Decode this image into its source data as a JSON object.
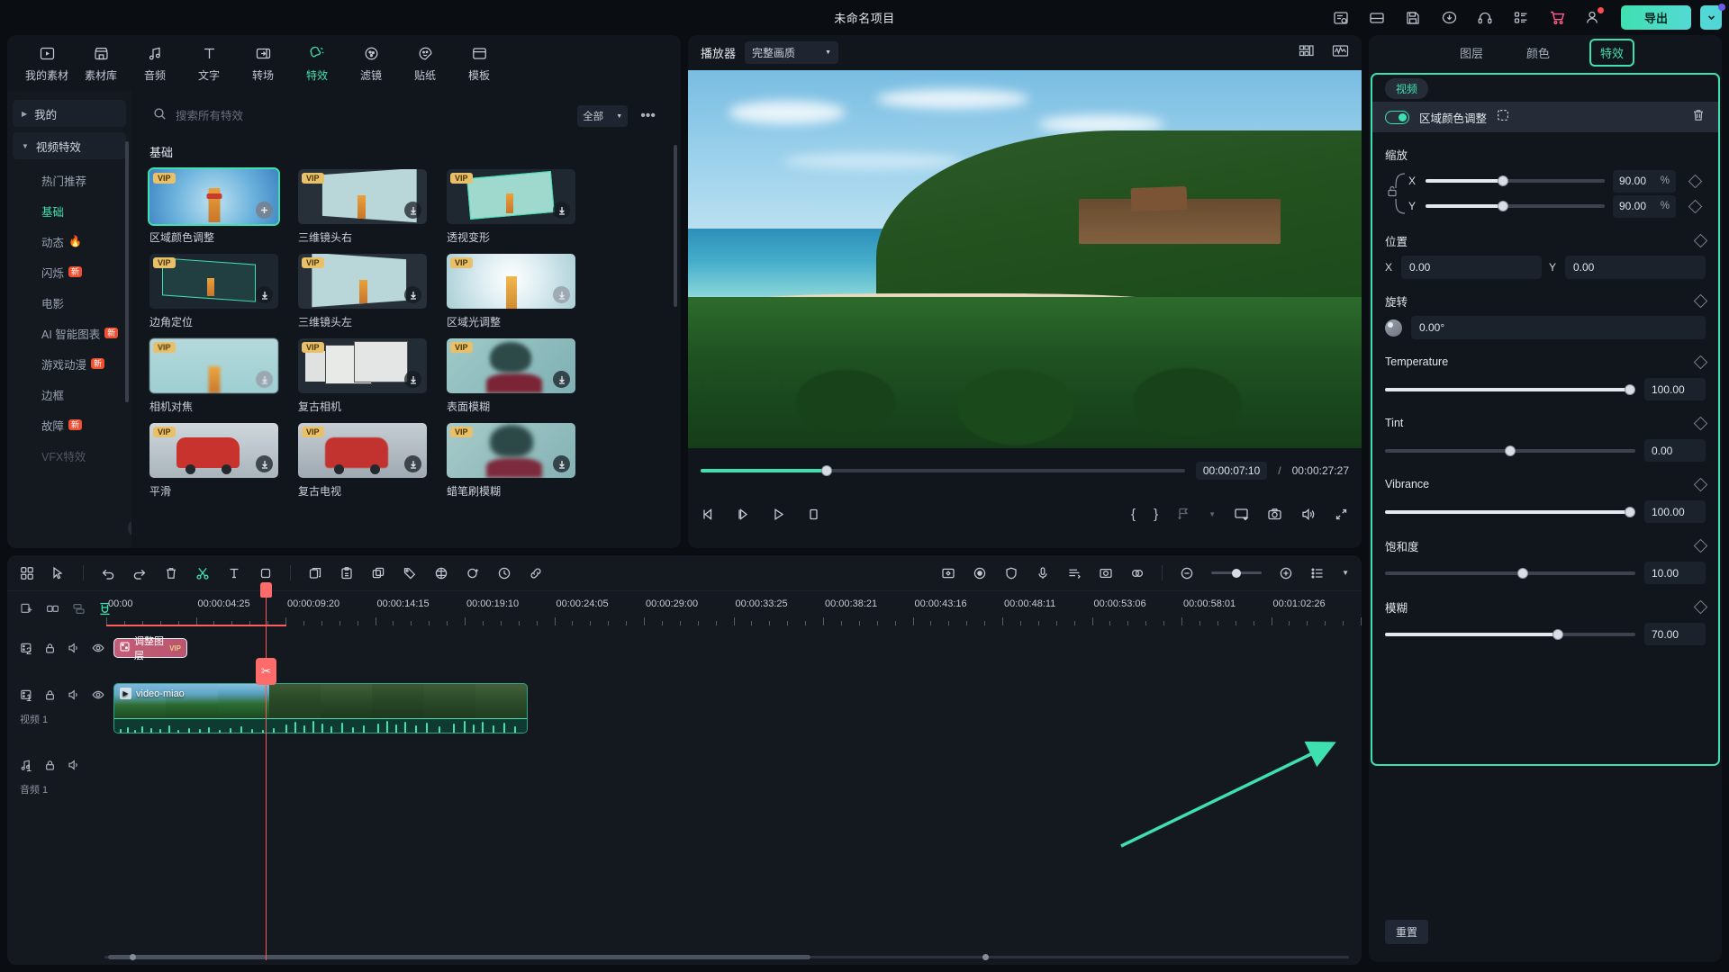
{
  "titlebar": {
    "project_title": "未命名项目",
    "export_label": "导出",
    "icons": [
      "notes-icon",
      "layout-icon",
      "save-icon",
      "cloud-upload-icon",
      "headset-icon",
      "apps-grid-icon",
      "cart-icon",
      "account-icon"
    ]
  },
  "media_panel": {
    "tabs": [
      {
        "label": "我的素材",
        "icon": "media-library-icon",
        "active": false
      },
      {
        "label": "素材库",
        "icon": "stock-store-icon",
        "active": false
      },
      {
        "label": "音频",
        "icon": "music-note-icon",
        "active": false
      },
      {
        "label": "文字",
        "icon": "text-t-icon",
        "active": false
      },
      {
        "label": "转场",
        "icon": "transition-icon",
        "active": false
      },
      {
        "label": "特效",
        "icon": "effects-sparkle-icon",
        "active": true
      },
      {
        "label": "滤镜",
        "icon": "filter-circle-icon",
        "active": false
      },
      {
        "label": "贴纸",
        "icon": "sticker-face-icon",
        "active": false
      },
      {
        "label": "模板",
        "icon": "template-icon",
        "active": false
      }
    ],
    "categories": [
      {
        "label": "我的",
        "type": "group",
        "expanded": false
      },
      {
        "label": "视频特效",
        "type": "group",
        "expanded": true
      },
      {
        "label": "热门推荐",
        "type": "item",
        "active": false,
        "tag": ""
      },
      {
        "label": "基础",
        "type": "item",
        "active": true,
        "tag": ""
      },
      {
        "label": "动态",
        "type": "item",
        "active": false,
        "tag": "🔥"
      },
      {
        "label": "闪烁",
        "type": "item",
        "active": false,
        "tag": "新"
      },
      {
        "label": "电影",
        "type": "item",
        "active": false,
        "tag": ""
      },
      {
        "label": "AI 智能图表",
        "type": "item",
        "active": false,
        "tag": "新"
      },
      {
        "label": "游戏动漫",
        "type": "item",
        "active": false,
        "tag": "新"
      },
      {
        "label": "边框",
        "type": "item",
        "active": false,
        "tag": ""
      },
      {
        "label": "故障",
        "type": "item",
        "active": false,
        "tag": "新"
      },
      {
        "label": "VFX特效",
        "type": "item",
        "active": false,
        "tag": ""
      }
    ],
    "search": {
      "placeholder": "搜索所有特效"
    },
    "filter": {
      "label": "全部"
    },
    "section_title": "基础",
    "effects": [
      {
        "name": "区域颜色调整",
        "vip": true,
        "selected": true,
        "action": "add"
      },
      {
        "name": "三维镜头右",
        "vip": true,
        "selected": false,
        "action": "download"
      },
      {
        "name": "透视变形",
        "vip": true,
        "selected": false,
        "action": "download"
      },
      {
        "name": "边角定位",
        "vip": true,
        "selected": false,
        "action": "download"
      },
      {
        "name": "三维镜头左",
        "vip": true,
        "selected": false,
        "action": "download"
      },
      {
        "name": "区域光调整",
        "vip": true,
        "selected": false,
        "action": "download"
      },
      {
        "name": "相机对焦",
        "vip": true,
        "selected": false,
        "action": "download"
      },
      {
        "name": "复古相机",
        "vip": true,
        "selected": false,
        "action": "download"
      },
      {
        "name": "表面模糊",
        "vip": true,
        "selected": false,
        "action": "download"
      },
      {
        "name": "平滑",
        "vip": true,
        "selected": false,
        "action": "download"
      },
      {
        "name": "复古电视",
        "vip": true,
        "selected": false,
        "action": "download"
      },
      {
        "name": "蜡笔刷模糊",
        "vip": true,
        "selected": false,
        "action": "download"
      }
    ]
  },
  "player": {
    "label": "播放器",
    "quality": "完整画质",
    "current_time": "00:00:07:10",
    "separator": "/",
    "total_time": "00:00:27:27",
    "progress_percent": 26,
    "controls": [
      "prev-frame-icon",
      "next-frame-icon",
      "play-icon",
      "stop-icon"
    ],
    "right_controls": [
      "mark-in-brace",
      "mark-out-brace",
      "add-marker-icon",
      "chevron-down-icon",
      "screen-icon",
      "snapshot-icon",
      "volume-icon",
      "fullscreen-icon"
    ],
    "head_right_icons": [
      "grid-layout-icon",
      "waveform-scope-icon"
    ]
  },
  "properties": {
    "tabs": [
      {
        "label": "图层",
        "active": false
      },
      {
        "label": "颜色",
        "active": false
      },
      {
        "label": "特效",
        "active": true
      }
    ],
    "sub_tab": "视频",
    "effect_name": "区域颜色调整",
    "effect_enabled": true,
    "mask_icon": "mask-select-icon",
    "delete_icon": "trash-icon",
    "scale": {
      "label": "缩放",
      "x": {
        "axis": "X",
        "value": "90.00",
        "unit": "%",
        "percent": 43
      },
      "y": {
        "axis": "Y",
        "value": "90.00",
        "unit": "%",
        "percent": 43
      },
      "linked": true
    },
    "position": {
      "label": "位置",
      "x": {
        "axis": "X",
        "value": "0.00"
      },
      "y": {
        "axis": "Y",
        "value": "0.00"
      }
    },
    "rotation": {
      "label": "旋转",
      "value": "0.00°"
    },
    "adjustments": [
      {
        "label": "Temperature",
        "value": "100.00",
        "percent": 98
      },
      {
        "label": "Tint",
        "value": "0.00",
        "percent": 50
      },
      {
        "label": "Vibrance",
        "value": "100.00",
        "percent": 98
      },
      {
        "label": "饱和度",
        "value": "10.00",
        "percent": 55
      },
      {
        "label": "模糊",
        "value": "70.00",
        "percent": 69
      }
    ],
    "reset_label": "重置"
  },
  "timeline": {
    "toolbar_left": [
      "grid-view-icon",
      "select-cursor-icon",
      "undo-icon",
      "redo-icon",
      "delete-icon",
      "split-scissors-icon",
      "text-tool-icon",
      "crop-icon",
      "copy-icon",
      "paste-icon",
      "duplicate-icon",
      "tag-icon",
      "color-match-icon",
      "auto-highlight-icon",
      "speed-clock-icon",
      "link-icon"
    ],
    "toolbar_right": [
      "keyframe-panel-icon",
      "record-icon",
      "shield-icon",
      "mic-icon",
      "subtitle-icon",
      "snapshot-track-icon",
      "transition-add-icon",
      "zoom-out-icon",
      "zoom-slider",
      "zoom-in-icon",
      "track-list-icon",
      "chevron-down-icon"
    ],
    "zoom_percent": 45,
    "ruler_icons": [
      "add-track-icon",
      "link-clip-icon",
      "split-track-icon",
      "magnet-snap-icon"
    ],
    "ruler_labels": [
      "00:00",
      "00:00:04:25",
      "00:00:09:20",
      "00:00:14:15",
      "00:00:19:10",
      "00:00:24:05",
      "00:00:29:00",
      "00:00:33:25",
      "00:00:38:21",
      "00:00:43:16",
      "00:00:48:11",
      "00:00:53:06",
      "00:00:58:01",
      "00:01:02:26"
    ],
    "tracks": [
      {
        "num": "2",
        "type": "video",
        "name": "",
        "icons": [
          "track-type-icon",
          "lock-icon",
          "mute-icon",
          "eye-icon"
        ],
        "clip": {
          "label": "调整图层",
          "vip": "VIP",
          "kind": "adjustment"
        }
      },
      {
        "num": "1",
        "type": "video",
        "name": "视频 1",
        "icons": [
          "track-type-icon",
          "lock-icon",
          "mute-icon",
          "eye-icon"
        ],
        "clip": {
          "label": "video-miao",
          "kind": "video"
        }
      },
      {
        "num": "1",
        "type": "audio",
        "name": "音频 1",
        "icons": [
          "music-track-icon",
          "lock-icon",
          "mute-icon"
        ],
        "clip": null
      }
    ]
  },
  "annotation": {
    "arrow_color": "#3fe0b0"
  },
  "colors": {
    "accent": "#3fe0b0",
    "panel_bg": "#141920",
    "deep_bg": "#0a0d12",
    "playhead": "#ff5757",
    "vip_badge": "#e8c06a",
    "tag_red": "#f04f31"
  }
}
